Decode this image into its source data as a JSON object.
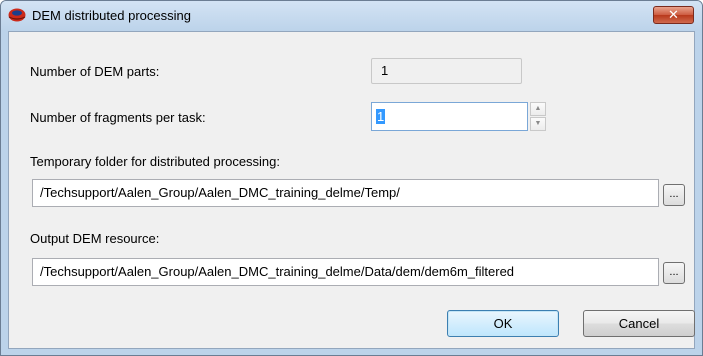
{
  "window": {
    "title": "DEM distributed processing",
    "close_label": "✕"
  },
  "form": {
    "parts_label": "Number of DEM parts:",
    "parts_value": "1",
    "fragments_label": "Number of fragments per task:",
    "fragments_value": "1",
    "temp_folder_label": "Temporary folder for distributed processing:",
    "temp_folder_value": "/Techsupport/Aalen_Group/Aalen_DMC_training_delme/Temp/",
    "output_label": "Output DEM resource:",
    "output_value": "/Techsupport/Aalen_Group/Aalen_DMC_training_delme/Data/dem/dem6m_filtered",
    "browse_label": "...",
    "spin_up": "▲",
    "spin_down": "▼"
  },
  "buttons": {
    "ok": "OK",
    "cancel": "Cancel"
  },
  "colors": {
    "frame": "#bcd3ea",
    "client": "#f0f0f0",
    "close": "#c94a2e",
    "selection": "#3399ff"
  }
}
